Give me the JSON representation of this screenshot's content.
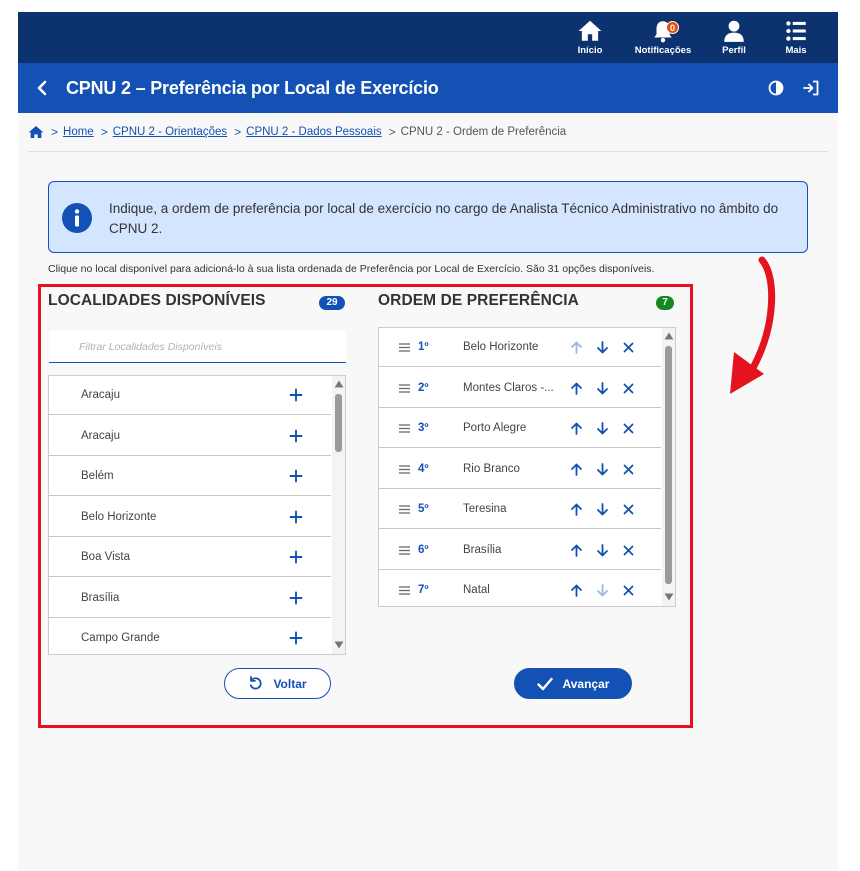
{
  "nav": {
    "items": [
      {
        "label": "Início",
        "icon": "home-icon"
      },
      {
        "label": "Notificações",
        "icon": "bell-icon",
        "badge": "0"
      },
      {
        "label": "Perfil",
        "icon": "user-icon"
      },
      {
        "label": "Mais",
        "icon": "list-icon"
      }
    ]
  },
  "header": {
    "title": "CPNU 2 – Preferência por Local de Exercício"
  },
  "breadcrumb": {
    "links": [
      "Home",
      "CPNU 2 - Orientações",
      "CPNU 2 - Dados Pessoais"
    ],
    "current": "CPNU 2 - Ordem de Preferência"
  },
  "alert": {
    "text": "Indique, a ordem de preferência por local de exercício no cargo de Analista Técnico Administrativo no âmbito do CPNU 2."
  },
  "hint": "Clique no local disponível para adicioná-lo à sua lista ordenada de Preferência por Local de Exercício. São 31 opções disponíveis.",
  "available": {
    "title": "LOCALIDADES DISPONÍVEIS",
    "count": "29",
    "filter_placeholder": "Filtrar Localidades Disponíveis",
    "items": [
      "Aracaju",
      "Aracaju",
      "Belém",
      "Belo Horizonte",
      "Boa Vista",
      "Brasília",
      "Campo Grande"
    ]
  },
  "preference": {
    "title": "ORDEM DE PREFERÊNCIA",
    "count": "7",
    "items": [
      {
        "rank": "1º",
        "name": "Belo Horizonte",
        "up_enabled": false,
        "down_enabled": true
      },
      {
        "rank": "2º",
        "name": "Montes Claros -...",
        "up_enabled": true,
        "down_enabled": true
      },
      {
        "rank": "3º",
        "name": "Porto Alegre",
        "up_enabled": true,
        "down_enabled": true
      },
      {
        "rank": "4º",
        "name": "Rio Branco",
        "up_enabled": true,
        "down_enabled": true
      },
      {
        "rank": "5º",
        "name": "Teresina",
        "up_enabled": true,
        "down_enabled": true
      },
      {
        "rank": "6º",
        "name": "Brasília",
        "up_enabled": true,
        "down_enabled": true
      },
      {
        "rank": "7º",
        "name": "Natal",
        "up_enabled": true,
        "down_enabled": false
      }
    ]
  },
  "buttons": {
    "back": "Voltar",
    "next": "Avançar"
  },
  "colors": {
    "nav_bg": "#0c326f",
    "primary": "#1351b4",
    "badge_available": "#1351b4",
    "badge_preference": "#168821",
    "alert_bg": "#d4e5ff",
    "annotation": "#e3141f",
    "notif_badge": "#e84e0f"
  }
}
